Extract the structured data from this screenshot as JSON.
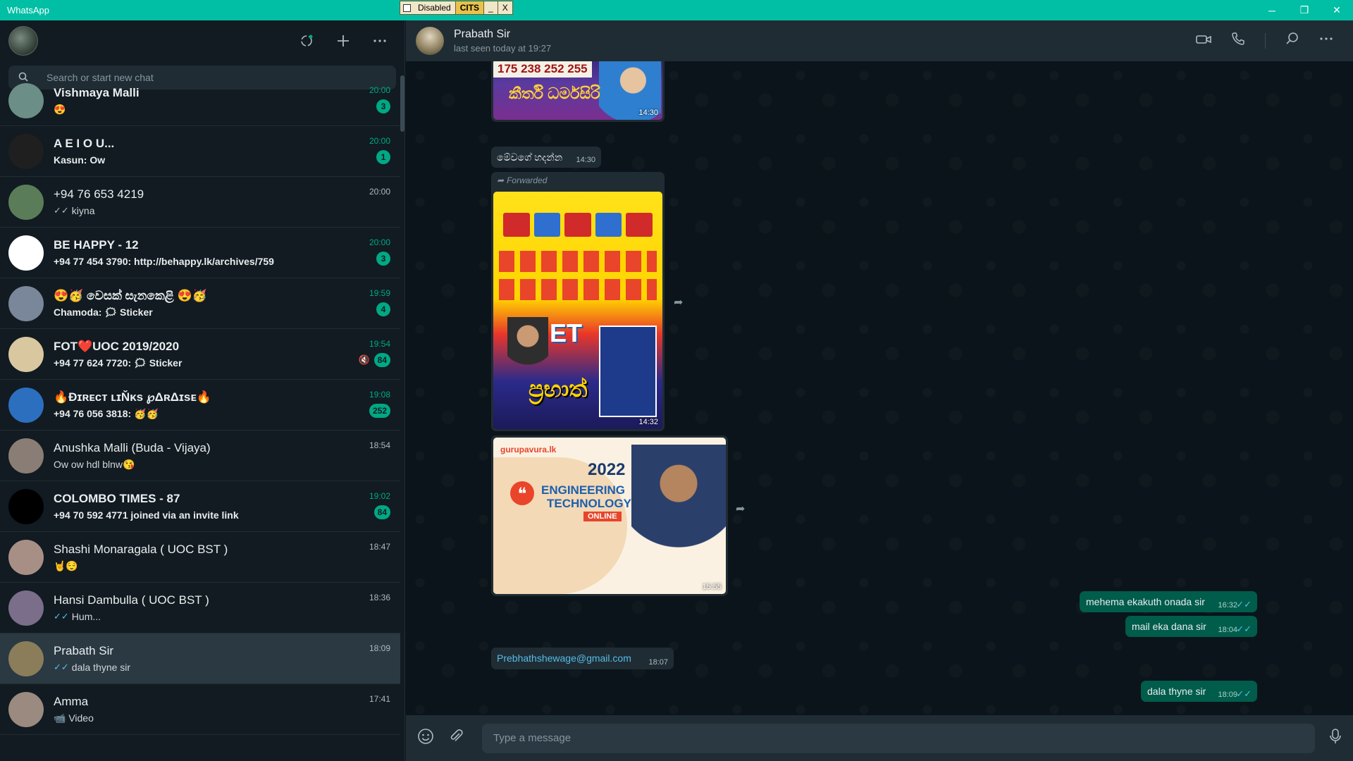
{
  "window": {
    "title": "WhatsApp",
    "cits": {
      "status": "Disabled",
      "name": "CITS",
      "min": "_",
      "close": "X"
    },
    "controls": {
      "minimize": "─",
      "maximize": "❐",
      "close": "✕"
    }
  },
  "sidebar": {
    "search_placeholder": "Search or start new chat",
    "chats": [
      {
        "name": "Vishmaya Malli",
        "msg": "😍",
        "time": "20:00",
        "badge": "3",
        "unread": true,
        "bold": true,
        "tick": "",
        "muted": false,
        "avatar_color": "#6b8e86"
      },
      {
        "name": "A E I O U...",
        "msg": "Kasun: Ow",
        "time": "20:00",
        "badge": "1",
        "unread": true,
        "bold": true,
        "tick": "",
        "muted": false,
        "avatar_color": "#1f1f1f"
      },
      {
        "name": "+94 76 653 4219",
        "msg": "kiyna",
        "time": "20:00",
        "badge": "",
        "unread": false,
        "bold": false,
        "tick": "grey",
        "muted": false,
        "avatar_color": "#5b7c58"
      },
      {
        "name": "BE HAPPY - 12",
        "msg": "+94 77 454 3790: http://behappy.lk/archives/759",
        "time": "20:00",
        "badge": "3",
        "unread": true,
        "bold": true,
        "tick": "",
        "muted": false,
        "avatar_color": "#ffffff"
      },
      {
        "name": "😍🥳 වෙසක් සැනකෙළි 😍🥳",
        "msg": "Chamoda: 🗯 Sticker",
        "time": "19:59",
        "badge": "4",
        "unread": true,
        "bold": true,
        "tick": "",
        "muted": false,
        "avatar_color": "#7a8699"
      },
      {
        "name": "FOT❤️UOC 2019/2020",
        "msg": "+94 77 624 7720: 🗯 Sticker",
        "time": "19:54",
        "badge": "84",
        "unread": true,
        "bold": true,
        "tick": "",
        "muted": true,
        "avatar_color": "#d9c7a0"
      },
      {
        "name": "🔥Đɪʀᴇᴄᴛ ʟɪŇᴋs ℘ΔʀΔɪsᴇ🔥",
        "msg": "+94 76 056 3818: 🥳🥳",
        "time": "19:08",
        "badge": "252",
        "unread": true,
        "bold": true,
        "tick": "",
        "muted": false,
        "avatar_color": "#2c6fbf"
      },
      {
        "name": "Anushka Malli (Buda - Vijaya)",
        "msg": "Ow ow hdl blnw😘",
        "time": "18:54",
        "badge": "",
        "unread": false,
        "bold": false,
        "tick": "",
        "muted": false,
        "avatar_color": "#8a7d75"
      },
      {
        "name": "COLOMBO TIMES - 87",
        "msg": "+94 70 592 4771 joined via an invite link",
        "time": "19:02",
        "badge": "84",
        "unread": true,
        "bold": true,
        "tick": "",
        "muted": false,
        "avatar_color": "#000000"
      },
      {
        "name": "Shashi Monaragala ( UOC BST )",
        "msg": "🤘😌",
        "time": "18:47",
        "badge": "",
        "unread": false,
        "bold": false,
        "tick": "",
        "muted": false,
        "avatar_color": "#a88f86"
      },
      {
        "name": "Hansi Dambulla ( UOC BST )",
        "msg": "Hum...",
        "time": "18:36",
        "badge": "",
        "unread": false,
        "bold": false,
        "tick": "blue",
        "muted": false,
        "avatar_color": "#7a6e8a"
      },
      {
        "name": "Prabath Sir",
        "msg": "dala thyne sir",
        "time": "18:09",
        "badge": "",
        "unread": false,
        "bold": false,
        "tick": "blue",
        "muted": false,
        "active": true,
        "avatar_color": "#8b7d5a"
      },
      {
        "name": "Amma",
        "msg": "📹 Video",
        "time": "17:41",
        "badge": "",
        "unread": false,
        "bold": false,
        "tick": "",
        "muted": false,
        "avatar_color": "#9a8a80"
      }
    ]
  },
  "conversation": {
    "contact_name": "Prabath Sir",
    "status": "last seen today at 19:27",
    "forwarded_label": "Forwarded",
    "image_1": {
      "caption_numbers": "175 238 252 255",
      "text": "කීර්ති ධර්මසිරි",
      "time": "14:30"
    },
    "text_in_1": {
      "text": "මේවගේ හදන්න",
      "time": "14:30"
    },
    "image_2": {
      "top": "ET",
      "name": "ප්‍රභාත්",
      "time": "14:32"
    },
    "image_3": {
      "brand": "gurupavura.lk",
      "year": "2022",
      "title_1": "ENGINEERING",
      "title_2": "TECHNOLOGY",
      "tag": "ONLINE",
      "time": "15:55"
    },
    "out_1": {
      "text": "mehema ekakuth onada sir",
      "time": "16:32"
    },
    "out_2": {
      "text": "mail eka dana sir",
      "time": "18:04"
    },
    "email": {
      "text": "Prebhathshewage@gmail.com",
      "time": "18:07"
    },
    "out_3": {
      "text": "dala thyne sir",
      "time": "18:09"
    },
    "input_placeholder": "Type a message"
  }
}
